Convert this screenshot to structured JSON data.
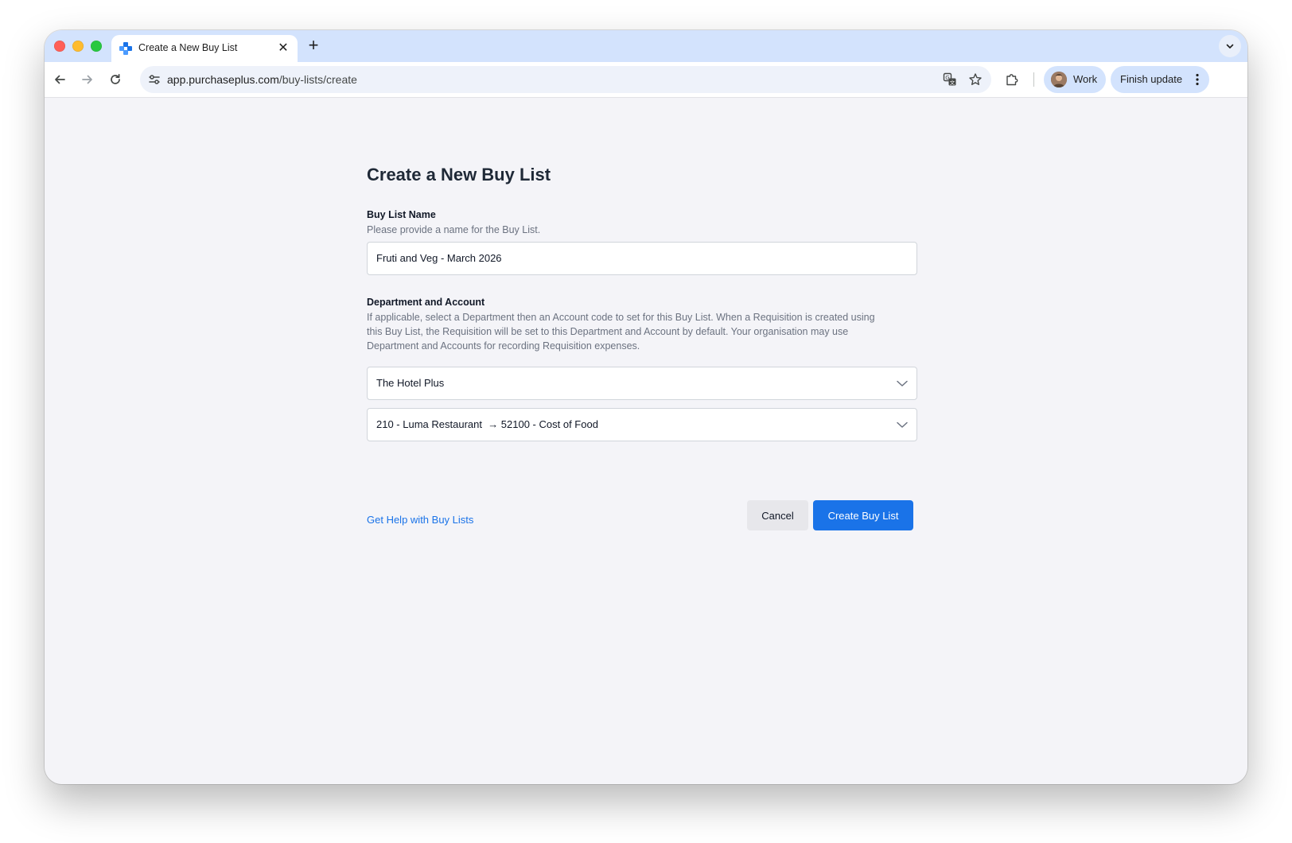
{
  "browser": {
    "tab": {
      "title": "Create a New Buy List",
      "favicon": "purchaseplus-logo-icon"
    },
    "new_tab_label": "+",
    "address": {
      "host": "app.purchaseplus.com",
      "path": "/buy-lists/create"
    },
    "profile": {
      "label": "Work"
    },
    "update_button": {
      "label": "Finish update"
    },
    "icons": {
      "back": "arrow-left-icon",
      "forward": "arrow-right-icon",
      "reload": "reload-icon",
      "site_info": "tune-icon",
      "translate": "translate-icon",
      "bookmark": "star-icon",
      "extensions": "puzzle-icon",
      "menu": "kebab-icon",
      "tab_search": "chevron-down-icon"
    }
  },
  "page": {
    "title": "Create a New Buy List",
    "name_section": {
      "label": "Buy List Name",
      "help": "Please provide a name for the Buy List.",
      "value": "Fruti and Veg - March 2026"
    },
    "dept_section": {
      "label": "Department and Account",
      "help_lines": [
        "If applicable, select a Department then an Account code to set for this Buy List. When a Requisition is created using",
        "this Buy List, the Requisition will be set to this Department and Account by default. Your organisation may use",
        "Department and Accounts for recording Requisition expenses."
      ],
      "department_value": "The Hotel Plus",
      "account_value": "210 - Luma Restaurant  → 52100 - Cost of Food"
    },
    "help_link": "Get Help with Buy Lists",
    "cancel_label": "Cancel",
    "create_label": "Create Buy List"
  },
  "colors": {
    "accent": "#1a73e8",
    "tab_strip": "#d3e3fd",
    "page_background": "#f4f4f8"
  }
}
